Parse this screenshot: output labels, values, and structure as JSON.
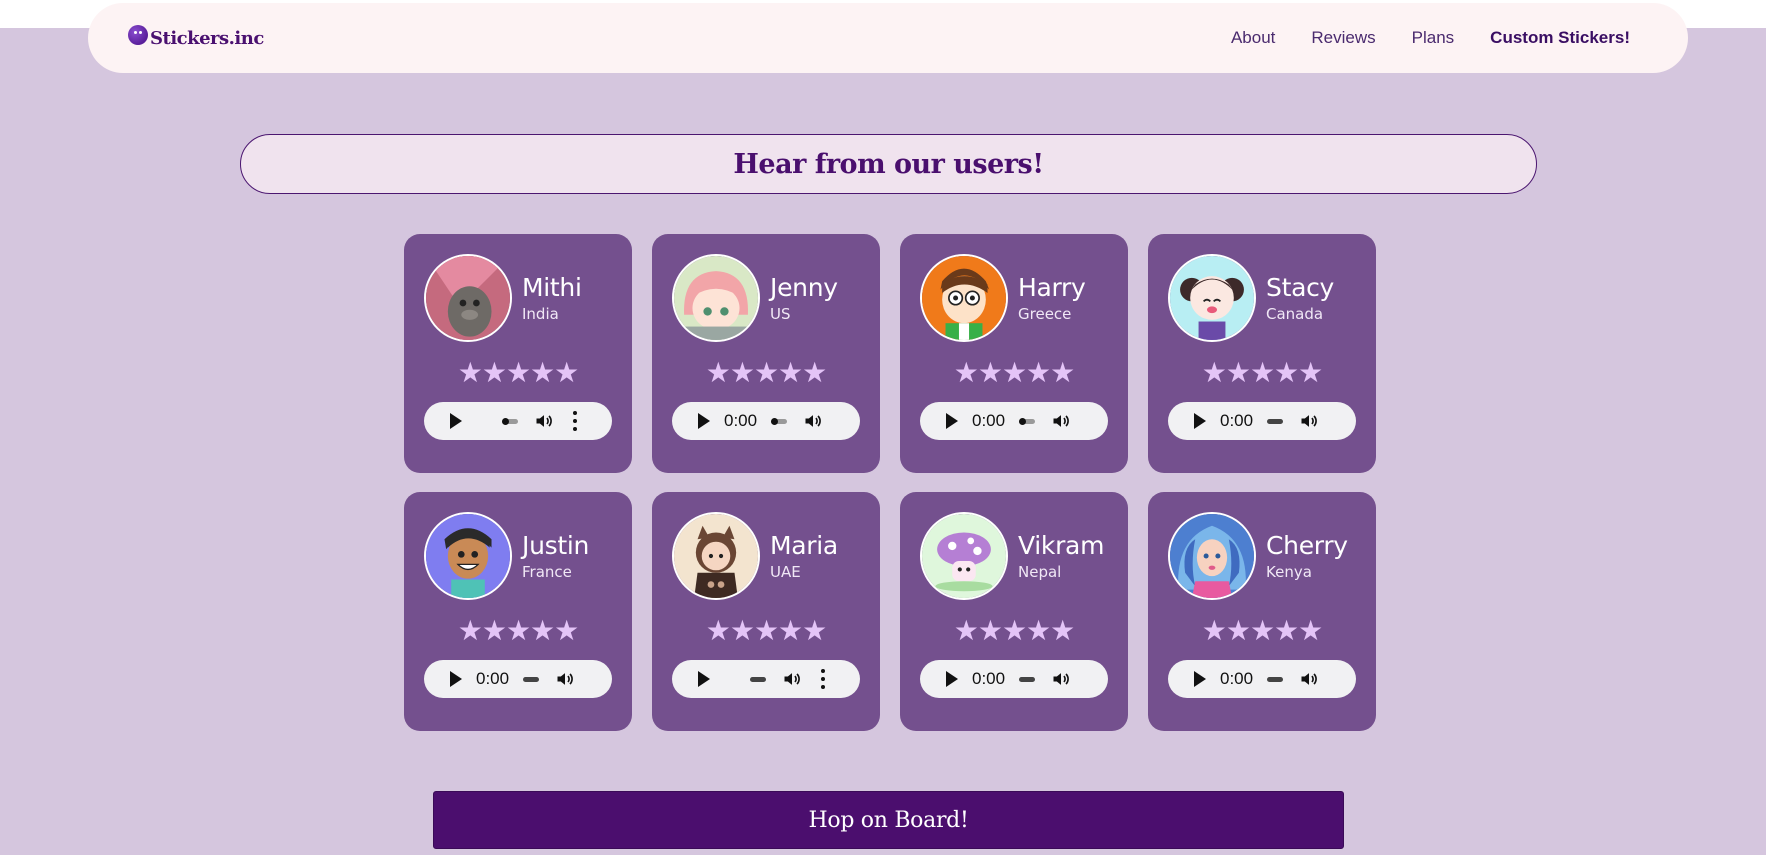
{
  "nav": {
    "logo_text": "Stickers.inc",
    "links": [
      {
        "label": "About"
      },
      {
        "label": "Reviews"
      },
      {
        "label": "Plans"
      },
      {
        "label": "Custom Stickers!"
      }
    ]
  },
  "section": {
    "title": "Hear from our users!"
  },
  "reviews": [
    {
      "name": "Mithi",
      "country": "India",
      "rating": 5,
      "time": "",
      "avatar_icon": "mithi-avatar-icon",
      "avatar_bg": "#c56a7e"
    },
    {
      "name": "Jenny",
      "country": "US",
      "rating": 5,
      "time": "0:00",
      "avatar_icon": "jenny-avatar-icon",
      "avatar_bg": "#d9e8c6"
    },
    {
      "name": "Harry",
      "country": "Greece",
      "rating": 5,
      "time": "0:00",
      "avatar_icon": "harry-avatar-icon",
      "avatar_bg": "#f07a1a"
    },
    {
      "name": "Stacy",
      "country": "Canada",
      "rating": 5,
      "time": "0:00",
      "avatar_icon": "stacy-avatar-icon",
      "avatar_bg": "#b8eef3"
    },
    {
      "name": "Justin",
      "country": "France",
      "rating": 5,
      "time": "0:00",
      "avatar_icon": "justin-avatar-icon",
      "avatar_bg": "#7f7df0"
    },
    {
      "name": "Maria",
      "country": "UAE",
      "rating": 5,
      "time": "",
      "avatar_icon": "maria-avatar-icon",
      "avatar_bg": "#f3e4cf"
    },
    {
      "name": "Vikram",
      "country": "Nepal",
      "rating": 5,
      "time": "0:00",
      "avatar_icon": "vikram-avatar-icon",
      "avatar_bg": "#dff7dc"
    },
    {
      "name": "Cherry",
      "country": "Kenya",
      "rating": 5,
      "time": "0:00",
      "avatar_icon": "cherry-avatar-icon",
      "avatar_bg": "#4d7fd0"
    }
  ],
  "cta": {
    "label": "Hop on Board!"
  },
  "colors": {
    "page_bg": "#d5c6de",
    "card_bg": "#74508e",
    "star": "#e4c4f7",
    "accent": "#4b0e6e"
  }
}
